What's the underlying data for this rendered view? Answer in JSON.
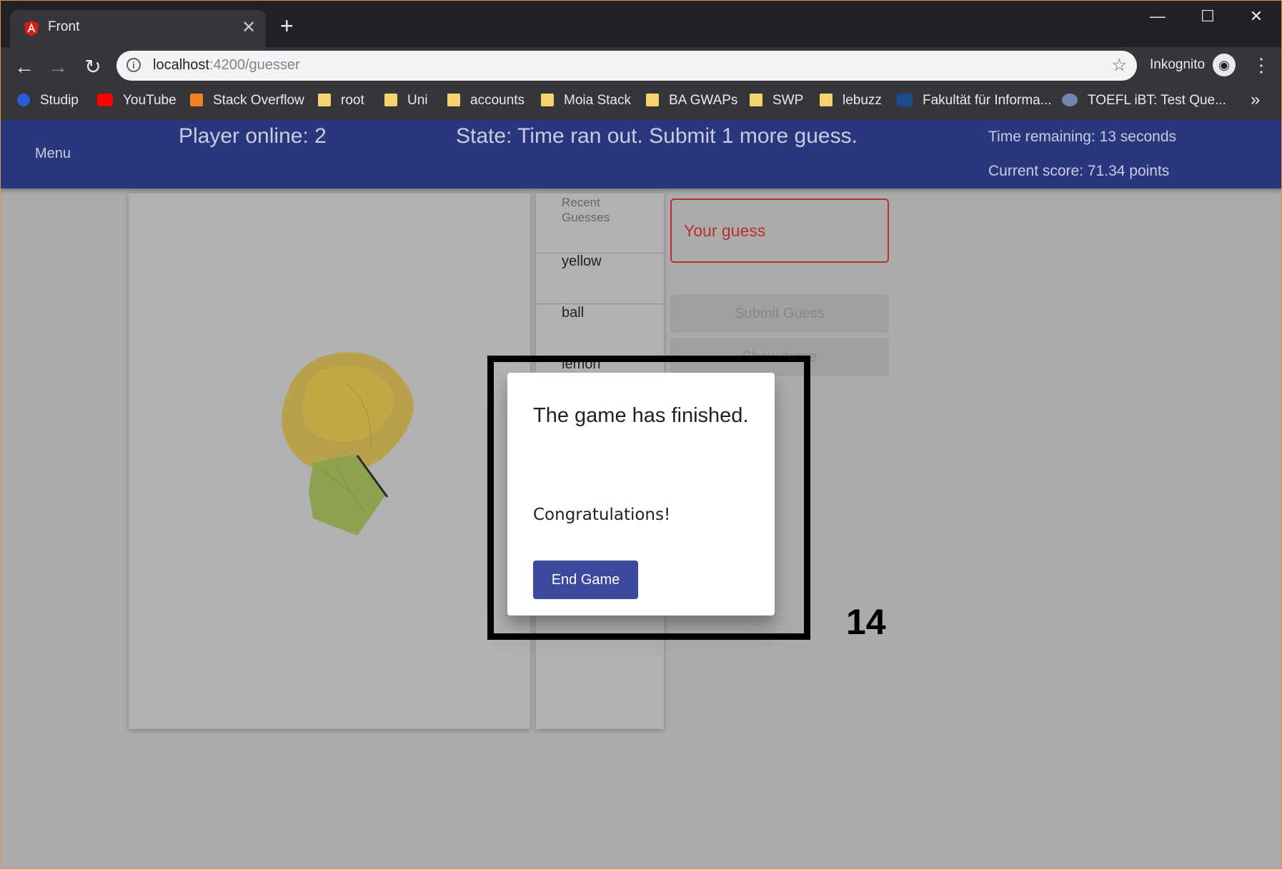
{
  "browser": {
    "tab_title": "Front",
    "tab_close": "✕",
    "new_tab": "+",
    "url_host": "localhost",
    "url_path": ":4200/guesser",
    "incognito_label": "Inkognito",
    "window_controls": {
      "minimize": "—",
      "maximize": "☐",
      "close": "✕"
    },
    "bookmarks": [
      {
        "label": "Studip",
        "icon": "studip-icon"
      },
      {
        "label": "YouTube",
        "icon": "youtube-icon"
      },
      {
        "label": "Stack Overflow",
        "icon": "stackoverflow-icon"
      },
      {
        "label": "root",
        "icon": "folder-icon"
      },
      {
        "label": "Uni",
        "icon": "folder-icon"
      },
      {
        "label": "accounts",
        "icon": "folder-icon"
      },
      {
        "label": "Moia Stack",
        "icon": "folder-icon"
      },
      {
        "label": "BA GWAPs",
        "icon": "folder-icon"
      },
      {
        "label": "SWP",
        "icon": "folder-icon"
      },
      {
        "label": "lebuzz",
        "icon": "folder-icon"
      },
      {
        "label": "Fakultät für Informa...",
        "icon": "kit-icon"
      },
      {
        "label": "TOEFL iBT: Test Que...",
        "icon": "toefl-icon"
      }
    ],
    "bookmarks_more": "»"
  },
  "header": {
    "menu": "Menu",
    "players_online": "Player online: 2",
    "state": "State: Time ran out. Submit 1 more guess.",
    "time_remaining": "Time remaining: 13 seconds",
    "current_score": "Current score: 71.34 points"
  },
  "guesses": {
    "heading": "Recent Guesses",
    "items": [
      "yellow",
      "ball",
      "lemon"
    ]
  },
  "guess_input": {
    "placeholder": "Your guess"
  },
  "buttons": {
    "submit": "Submit Guess",
    "show_score": "Show score"
  },
  "counter": "14",
  "dialog": {
    "title": "The game has finished.",
    "message": "Congratulations!",
    "button": "End Game"
  },
  "colors": {
    "header_bg": "#29377c",
    "dialog_button": "#3c4a9e",
    "error": "#b8302e"
  }
}
